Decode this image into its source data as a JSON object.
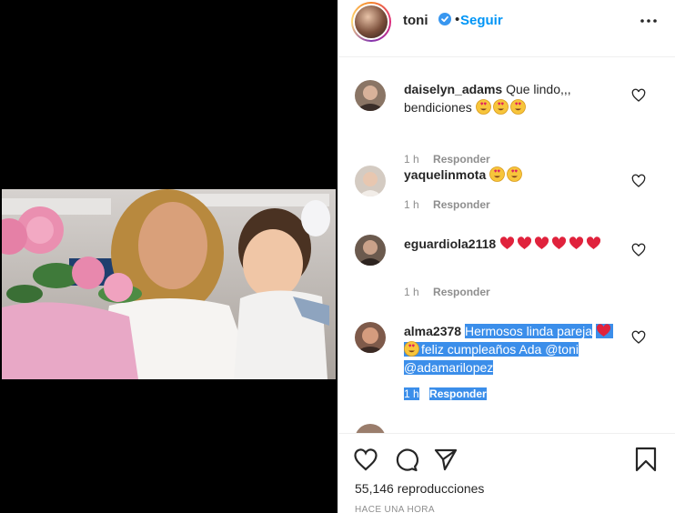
{
  "post": {
    "username": "toni",
    "separator": "•",
    "follow_label": "Seguir",
    "views_text": "55,146 reproducciones",
    "time_ago": "HACE UNA HORA"
  },
  "comments": [
    {
      "username": "daiselyn_adams",
      "text": "Que lindo,,, bendiciones",
      "emojis": [
        "heart-eyes",
        "heart-eyes",
        "heart-eyes"
      ],
      "time": "1 h",
      "reply_label": "Responder"
    },
    {
      "username": "yaquelinmota",
      "text": "",
      "emojis": [
        "heart-eyes",
        "heart-eyes"
      ],
      "time": "1 h",
      "reply_label": "Responder"
    },
    {
      "username": "eguardiola2118",
      "text": "",
      "emojis": [
        "red-heart",
        "red-heart",
        "red-heart",
        "red-heart",
        "red-heart",
        "red-heart"
      ],
      "time": "1 h",
      "reply_label": "Responder"
    },
    {
      "username": "alma2378",
      "text_part1": "Hermosos linda pareja",
      "text_part2": "feliz cumpleaños Ada @toni @adamarilopez",
      "emojis": [
        "red-heart",
        "heart-eyes"
      ],
      "time": "1 h",
      "reply_label": "Responder",
      "selected": true
    }
  ],
  "icons": {
    "verified": "verified-badge-icon",
    "more": "more-options-icon",
    "like": "heart-outline-icon",
    "comment": "comment-bubble-icon",
    "share": "paper-plane-icon",
    "save": "bookmark-icon"
  },
  "colors": {
    "accent": "#0095f6",
    "selection": "#3b8eea",
    "muted": "#8e8e8e",
    "text": "#262626"
  }
}
